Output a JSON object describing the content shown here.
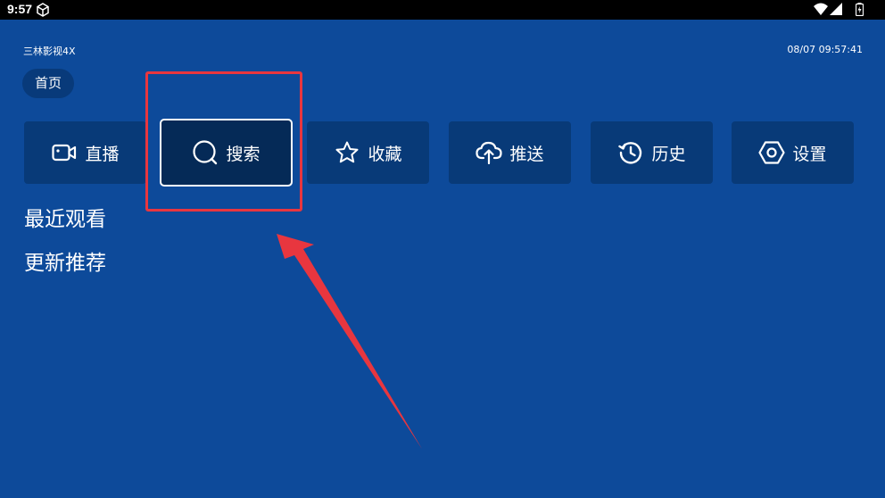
{
  "status_bar": {
    "time": "9:57",
    "icons": [
      "app-cube-icon",
      "wifi-icon",
      "signal-icon",
      "battery-icon"
    ]
  },
  "header": {
    "app_name": "三林影视4X",
    "clock": "08/07 09:57:41"
  },
  "tabs": [
    {
      "label": "首页"
    }
  ],
  "nav": [
    {
      "label": "直播",
      "icon": "video-camera-icon"
    },
    {
      "label": "搜索",
      "icon": "search-icon",
      "focused": true
    },
    {
      "label": "收藏",
      "icon": "star-icon"
    },
    {
      "label": "推送",
      "icon": "cloud-upload-icon"
    },
    {
      "label": "历史",
      "icon": "history-icon"
    },
    {
      "label": "设置",
      "icon": "settings-icon"
    }
  ],
  "sections": [
    {
      "title": "最近观看"
    },
    {
      "title": "更新推荐"
    }
  ],
  "annotation": {
    "color": "#e8363f"
  },
  "colors": {
    "background": "#0d4a9a",
    "button": "#083a78",
    "focused_button": "#052a57"
  }
}
